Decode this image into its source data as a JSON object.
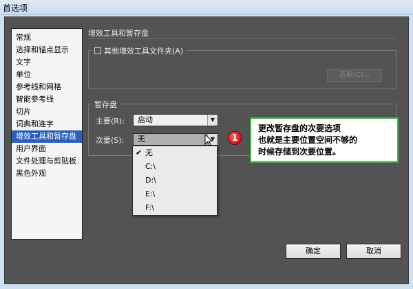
{
  "window": {
    "title": "首选项"
  },
  "sidebar": {
    "items": [
      {
        "label": "常规"
      },
      {
        "label": "选择和锚点显示"
      },
      {
        "label": "文字"
      },
      {
        "label": "单位"
      },
      {
        "label": "参考线和网格"
      },
      {
        "label": "智能参考线"
      },
      {
        "label": "切片"
      },
      {
        "label": "词典和连字"
      },
      {
        "label": "增效工具和暂存盘",
        "selected": true
      },
      {
        "label": "用户界面"
      },
      {
        "label": "文件处理与剪贴板"
      },
      {
        "label": "黑色外观"
      }
    ]
  },
  "plugins": {
    "section_title": "增效工具和暂存盘",
    "checkbox_label": "其他增效工具文件夹(A)",
    "checked": false,
    "choose_button_label": "选取(C)..."
  },
  "scratch": {
    "legend": "暂存盘",
    "primary_label": "主要(R):",
    "primary_value": "启动",
    "secondary_label": "次要(S):",
    "secondary_value": "无",
    "secondary_options": [
      {
        "label": "无",
        "checked": true
      },
      {
        "label": "C:\\"
      },
      {
        "label": "D:\\"
      },
      {
        "label": "E:\\"
      },
      {
        "label": "F:\\"
      }
    ]
  },
  "annotation": {
    "badge": "1",
    "lines": [
      "更改暂存盘的次要选项",
      "也就是主要位置空间不够的",
      "时候存储到次要位置。"
    ]
  },
  "buttons": {
    "ok_label": "确定",
    "cancel_label": "取消"
  },
  "icons": {
    "dropdown_arrow": "triangle-down-icon",
    "checkmark": "checkmark-icon",
    "cursor": "mouse-pointer-icon"
  },
  "colors": {
    "dialog_bg": "#535353",
    "selection": "#2b5fbf",
    "callout_border": "#42b642",
    "badge": "#d10000"
  }
}
